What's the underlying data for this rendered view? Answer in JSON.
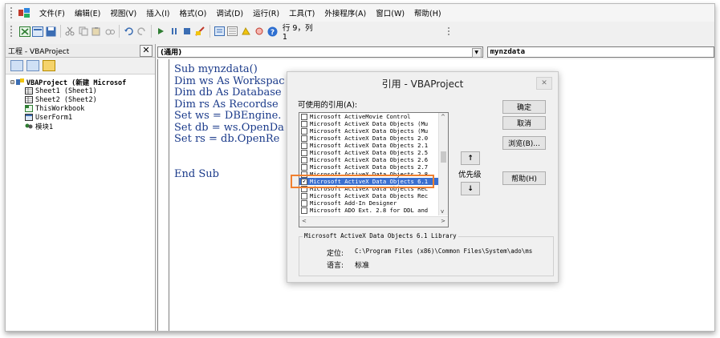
{
  "menubar": {
    "items": [
      "文件(F)",
      "编辑(E)",
      "视图(V)",
      "插入(I)",
      "格式(O)",
      "调试(D)",
      "运行(R)",
      "工具(T)",
      "外接程序(A)",
      "窗口(W)",
      "帮助(H)"
    ]
  },
  "toolbar": {
    "position_text": "行 9，列 1"
  },
  "project": {
    "title": "工程 - VBAProject",
    "close_label": "✕",
    "tree": [
      "VBAProject (新建 Microsof",
      "Sheet1 (Sheet1)",
      "Sheet2 (Sheet2)",
      "ThisWorkbook",
      "UserForm1",
      "模块1"
    ]
  },
  "code_header": {
    "object": "(通用)",
    "procedure": "mynzdata"
  },
  "code": {
    "lines": [
      "Sub mynzdata()",
      "Dim ws As Workspac",
      "Dim db As Database",
      "Dim rs As Recordse",
      "Set ws = DBEngine.",
      "Set db = ws.OpenDa",
      "Set rs = db.OpenRe",
      "",
      "",
      "End Sub"
    ]
  },
  "dialog": {
    "title": "引用 - VBAProject",
    "close_label": "✕",
    "available_label": "可使用的引用(A):",
    "references": [
      {
        "name": "Microsoft ActiveMovie Control",
        "checked": false
      },
      {
        "name": "Microsoft ActiveX Data Objects (Mu",
        "checked": false
      },
      {
        "name": "Microsoft ActiveX Data Objects (Mu",
        "checked": false
      },
      {
        "name": "Microsoft ActiveX Data Objects 2.0",
        "checked": false
      },
      {
        "name": "Microsoft ActiveX Data Objects 2.1",
        "checked": false
      },
      {
        "name": "Microsoft ActiveX Data Objects 2.5",
        "checked": false
      },
      {
        "name": "Microsoft ActiveX Data Objects 2.6",
        "checked": false
      },
      {
        "name": "Microsoft ActiveX Data Objects 2.7",
        "checked": false
      },
      {
        "name": "Microsoft ActiveX Data Objects 2.8",
        "checked": false
      },
      {
        "name": "Microsoft ActiveX Data Objects 6.1",
        "checked": true,
        "selected": true
      },
      {
        "name": "Microsoft ActiveX Data Objects Rec",
        "checked": false
      },
      {
        "name": "Microsoft ActiveX Data Objects Rec",
        "checked": false
      },
      {
        "name": "Microsoft Add-In Designer",
        "checked": false
      },
      {
        "name": "Microsoft ADO Ext. 2.8 for DDL and",
        "checked": false
      }
    ],
    "buttons": {
      "ok": "确定",
      "cancel": "取消",
      "browse": "浏览(B)...",
      "help": "帮助(H)"
    },
    "priority_label": "优先级",
    "priority_up": "↑",
    "priority_down": "↓",
    "group_title": "Microsoft ActiveX Data Objects 6.1 Library",
    "location_label": "定位:",
    "location_value": "C:\\Program Files (x86)\\Common Files\\System\\ado\\ms",
    "language_label": "语言:",
    "language_value": "标准"
  },
  "colors": {
    "highlight": "#f08030",
    "selection": "#3a6fd0",
    "code_text": "#1a3a8a"
  }
}
